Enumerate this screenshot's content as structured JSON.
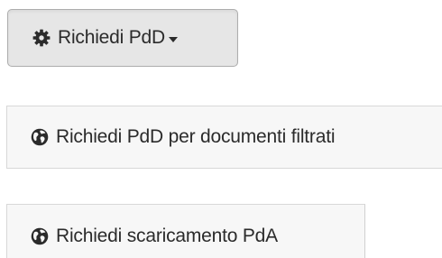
{
  "buttons": {
    "request_pdd": {
      "label": "Richiedi PdD",
      "icon": "gear-icon"
    },
    "request_pdd_filtered": {
      "label": "Richiedi PdD per documenti filtrati",
      "icon": "globe-icon"
    },
    "request_pda_download": {
      "label": "Richiedi scaricamento PdA",
      "icon": "globe-icon"
    }
  }
}
